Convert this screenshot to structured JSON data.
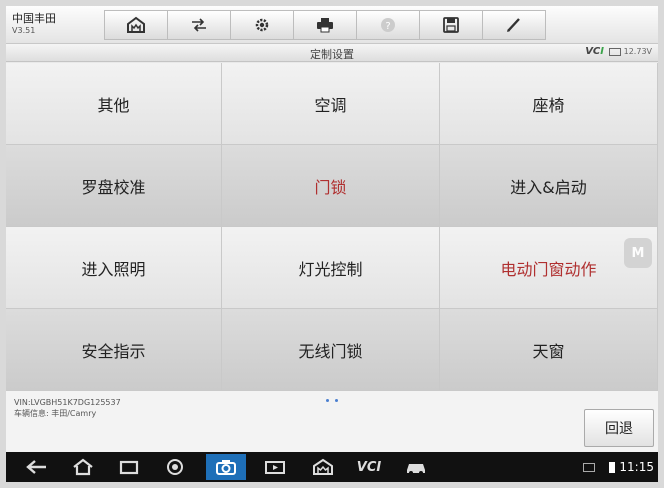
{
  "header": {
    "app_title": "中国丰田",
    "version": "V3.51"
  },
  "toolbar": {
    "buttons": [
      {
        "name": "home-icon"
      },
      {
        "name": "vehicle-swap-icon"
      },
      {
        "name": "settings-gear-icon"
      },
      {
        "name": "print-icon"
      },
      {
        "name": "help-icon"
      },
      {
        "name": "save-icon"
      },
      {
        "name": "edit-pen-icon"
      }
    ]
  },
  "titlebar": {
    "title": "定制设置",
    "vci_prefix": "VC",
    "vci_suffix": "I",
    "battery": "12.73V"
  },
  "menu": {
    "items": [
      {
        "label": "其他",
        "highlight": false
      },
      {
        "label": "空调",
        "highlight": false
      },
      {
        "label": "座椅",
        "highlight": false
      },
      {
        "label": "罗盘校准",
        "highlight": false
      },
      {
        "label": "门锁",
        "highlight": true
      },
      {
        "label": "进入&启动",
        "highlight": false
      },
      {
        "label": "进入照明",
        "highlight": false
      },
      {
        "label": "灯光控制",
        "highlight": false
      },
      {
        "label": "电动门窗动作",
        "highlight": true
      },
      {
        "label": "安全指示",
        "highlight": false
      },
      {
        "label": "无线门锁",
        "highlight": false
      },
      {
        "label": "天窗",
        "highlight": false
      }
    ],
    "highlight_color": "#b03030"
  },
  "side_tab": {
    "label": "M"
  },
  "footer": {
    "vin": "VIN:LVGBH51K7DG125537",
    "vehicle_info": "车辆信息: 丰田/Camry",
    "back_label": "回退"
  },
  "navbar": {
    "time": "11:15",
    "vci_label": "VCI"
  },
  "colors": {
    "accent": "#1e6fb8",
    "vci_green": "#3aa34a"
  }
}
